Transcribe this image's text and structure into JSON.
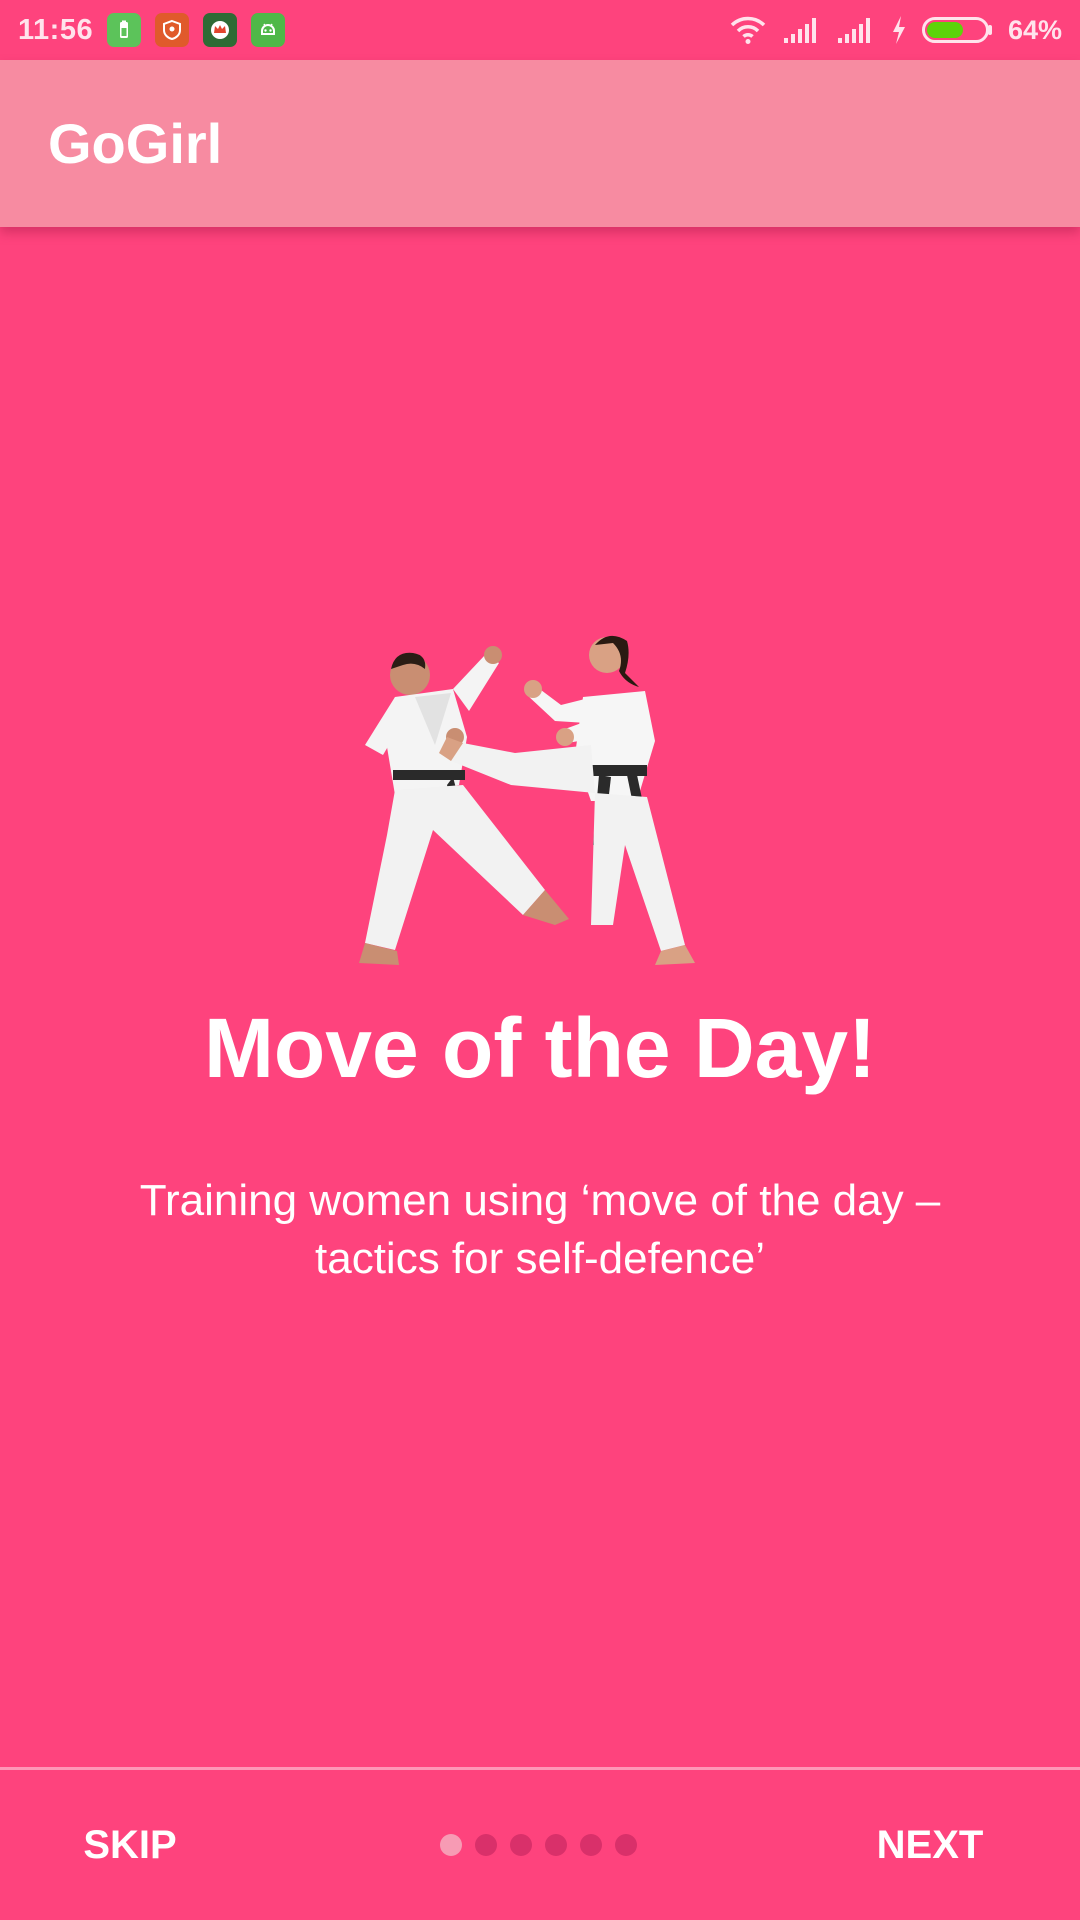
{
  "status_bar": {
    "time": "11:56",
    "notifications": [
      {
        "icon": "battery-saver-icon",
        "color": "#5cc35a"
      },
      {
        "icon": "shield-app-icon",
        "color": "#e05a2b"
      },
      {
        "icon": "crown-app-icon",
        "color": "#ffffff"
      },
      {
        "icon": "android-app-icon",
        "color": "#4fb848"
      }
    ],
    "battery_percent": "64%",
    "battery_level": 0.64,
    "battery_color": "#5dd40a"
  },
  "app_bar": {
    "title": "GoGirl",
    "color": "#f78ba1"
  },
  "slide": {
    "illustration": "karate-sparring-illustration",
    "title": "Move of the Day!",
    "description": "Training women using ‘move of the day – tactics for self-defence’",
    "background": "#fe437d"
  },
  "bottom_bar": {
    "skip_label": "SKIP",
    "next_label": "NEXT",
    "page_count": 6,
    "current_page": 1
  }
}
